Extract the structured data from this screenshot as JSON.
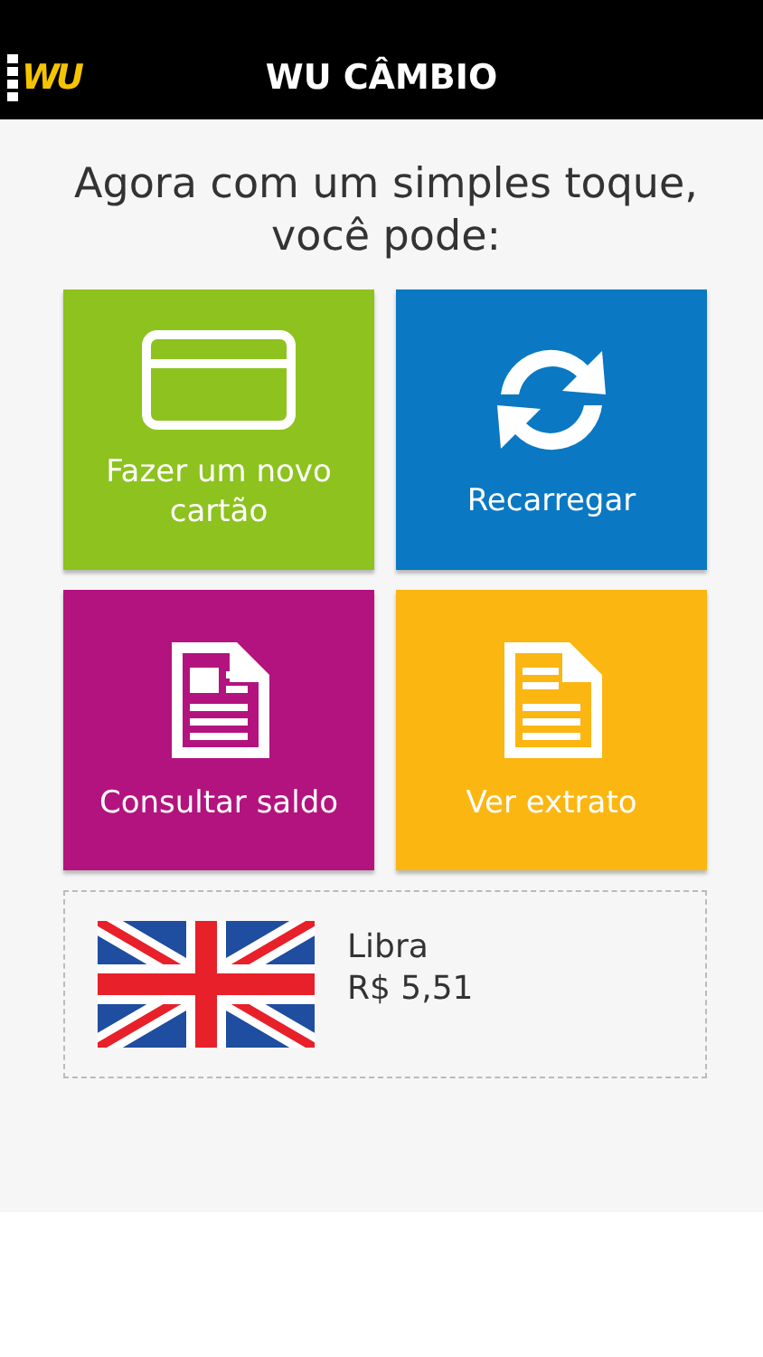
{
  "app_bar": {
    "logo": "WU",
    "title": "WU CÂMBIO"
  },
  "headline": "Agora com um simples toque, você pode:",
  "tiles": [
    {
      "label": "Fazer um novo cartão",
      "kind": "card",
      "color": "#8dc21f"
    },
    {
      "label": "Recarregar",
      "kind": "refresh",
      "color": "#0a78c2"
    },
    {
      "label": "Consultar saldo",
      "kind": "document",
      "color": "#b3137f"
    },
    {
      "label": "Ver extrato",
      "kind": "document-lines",
      "color": "#fbb612"
    }
  ],
  "currency": {
    "name": "Libra",
    "rate": "R$ 5,51"
  }
}
